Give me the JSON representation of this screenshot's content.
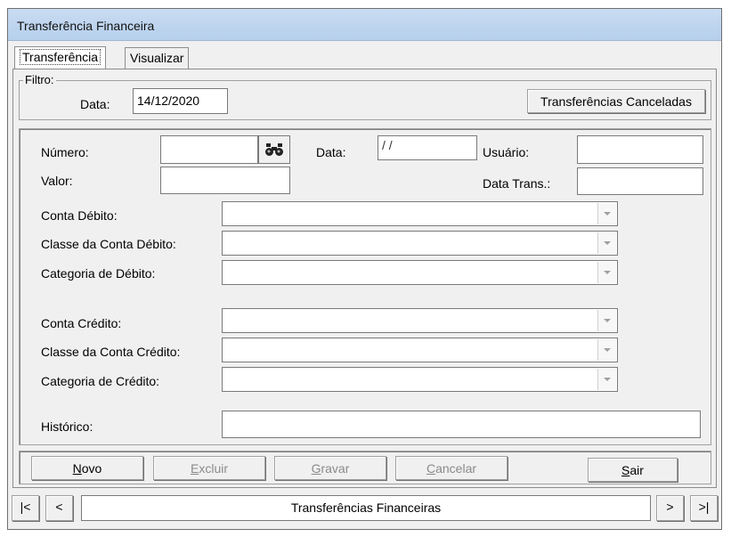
{
  "window": {
    "title": "Transferência Financeira"
  },
  "tabs": [
    {
      "label": "Transferência",
      "active": true
    },
    {
      "label": "Visualizar",
      "active": false
    }
  ],
  "filter": {
    "legend": "Filtro:",
    "date_label": "Data:",
    "date_value": "14/12/2020",
    "canceled_button": "Transferências Canceladas"
  },
  "form": {
    "numero_label": "Número:",
    "numero_value": "",
    "data_label": "Data:",
    "data_value": " / /",
    "usuario_label": "Usuário:",
    "usuario_value": "",
    "valor_label": "Valor:",
    "valor_value": "",
    "data_trans_label": "Data Trans.:",
    "data_trans_value": "",
    "conta_debito_label": "Conta Débito:",
    "classe_debito_label": "Classe da Conta Débito:",
    "categoria_debito_label": "Categoria de Débito:",
    "conta_credito_label": "Conta Crédito:",
    "classe_credito_label": "Classe da Conta Crédito:",
    "categoria_credito_label": "Categoria de Crédito:",
    "historico_label": "Histórico:",
    "historico_value": ""
  },
  "actions": {
    "novo": {
      "accel": "N",
      "rest": "ovo"
    },
    "excluir": {
      "accel": "E",
      "rest": "xcluir"
    },
    "gravar": {
      "accel": "G",
      "rest": "ravar"
    },
    "cancelar": {
      "accel": "C",
      "rest": "ancelar"
    },
    "sair": {
      "accel": "S",
      "rest": "air"
    }
  },
  "navigator": {
    "first": "|<",
    "prev": "<",
    "caption": "Transferências Financeiras",
    "next": ">",
    "last": ">|"
  },
  "icons": {
    "search": "binoculars-icon",
    "dropdown": "chevron-down-icon"
  },
  "colors": {
    "titlebar": "#c4d9f1",
    "face": "#f0f0f0",
    "disabled_text": "#8a8a8a"
  }
}
